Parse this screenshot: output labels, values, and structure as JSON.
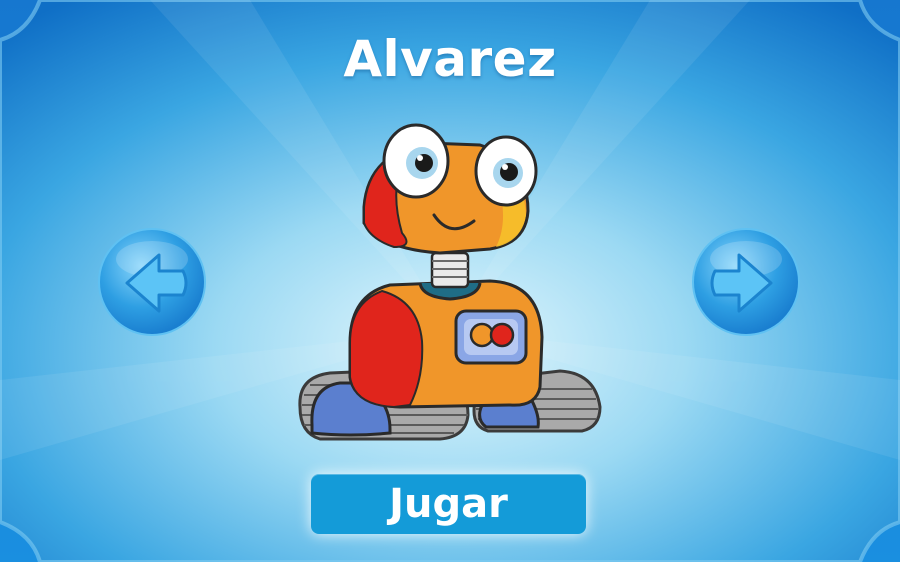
{
  "screen": {
    "character_name": "Alvarez",
    "play_label": "Jugar"
  },
  "icons": {
    "previous": "arrow-left-icon",
    "next": "arrow-right-icon",
    "character": "robot-character"
  },
  "colors": {
    "background_center": "#d6f1fb",
    "background_edge": "#0f6fc6",
    "button": "#149bd8",
    "text": "#ffffff"
  }
}
